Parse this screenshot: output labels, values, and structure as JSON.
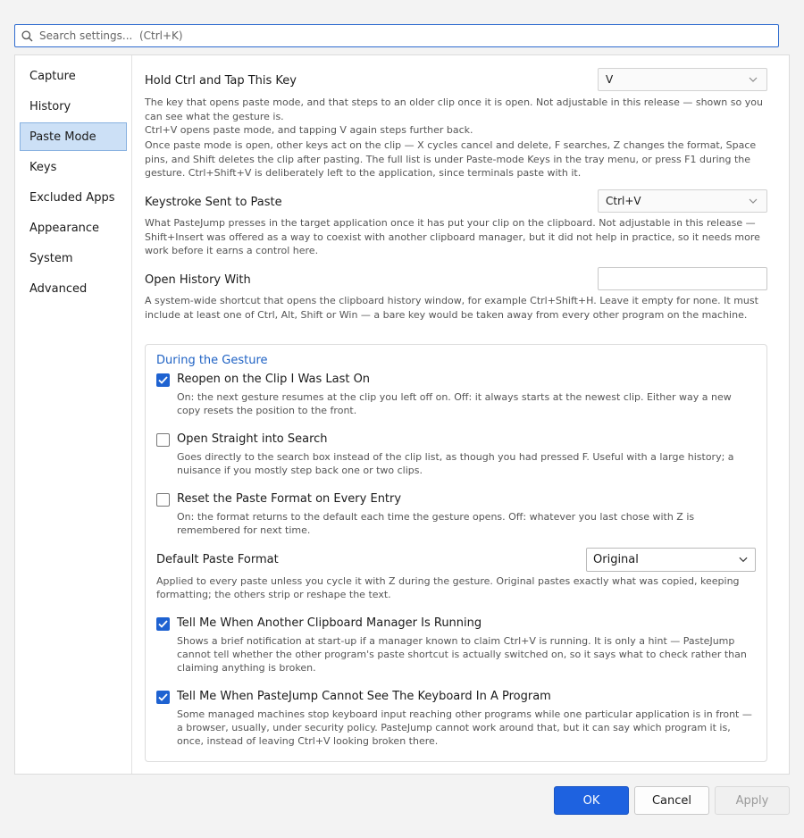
{
  "search": {
    "placeholder": "Search settings...  (Ctrl+K)",
    "value": ""
  },
  "sidebar": {
    "items": [
      {
        "label": "Capture"
      },
      {
        "label": "History"
      },
      {
        "label": "Paste Mode",
        "selected": true
      },
      {
        "label": "Keys"
      },
      {
        "label": "Excluded Apps"
      },
      {
        "label": "Appearance"
      },
      {
        "label": "System"
      },
      {
        "label": "Advanced"
      }
    ]
  },
  "settings": {
    "hold_key": {
      "title": "Hold Ctrl and Tap This Key",
      "value": "V",
      "desc1": "The key that opens paste mode, and that steps to an older clip once it is open. Not adjustable in this release — shown so you can see what the gesture is.",
      "desc2": "Ctrl+V opens paste mode, and tapping V again steps further back.",
      "desc3": "Once paste mode is open, other keys act on the clip — X cycles cancel and delete, F searches, Z changes the format, Space pins, and Shift deletes the clip after pasting. The full list is under Paste-mode Keys in the tray menu, or press F1 during the gesture. Ctrl+Shift+V is deliberately left to the application, since terminals paste with it."
    },
    "keystroke": {
      "title": "Keystroke Sent to Paste",
      "value": "Ctrl+V",
      "desc": "What PasteJump presses in the target application once it has put your clip on the clipboard. Not adjustable in this release — Shift+Insert was offered as a way to coexist with another clipboard manager, but it did not help in practice, so it needs more work before it earns a control here."
    },
    "open_history": {
      "title": "Open History With",
      "value": "",
      "desc": "A system-wide shortcut that opens the clipboard history window, for example Ctrl+Shift+H. Leave it empty for none. It must include at least one of Ctrl, Alt, Shift or Win — a bare key would be taken away from every other program on the machine."
    }
  },
  "gesture": {
    "title": "During the Gesture",
    "options": [
      {
        "label": "Reopen on the Clip I Was Last On",
        "checked": true,
        "desc": "On: the next gesture resumes at the clip you left off on. Off: it always starts at the newest clip. Either way a new copy resets the position to the front."
      },
      {
        "label": "Open Straight into Search",
        "checked": false,
        "desc": "Goes directly to the search box instead of the clip list, as though you had pressed F. Useful with a large history; a nuisance if you mostly step back one or two clips."
      },
      {
        "label": "Reset the Paste Format on Every Entry",
        "checked": false,
        "desc": "On: the format returns to the default each time the gesture opens. Off: whatever you last chose with Z is remembered for next time."
      }
    ],
    "default_format": {
      "label": "Default Paste Format",
      "value": "Original",
      "desc": "Applied to every paste unless you cycle it with Z during the gesture. Original pastes exactly what was copied, keeping formatting; the others strip or reshape the text."
    },
    "notices": [
      {
        "label": "Tell Me When Another Clipboard Manager Is Running",
        "checked": true,
        "desc": "Shows a brief notification at start-up if a manager known to claim Ctrl+V is running. It is only a hint — PasteJump cannot tell whether the other program's paste shortcut is actually switched on, so it says what to check rather than claiming anything is broken."
      },
      {
        "label": "Tell Me When PasteJump Cannot See The Keyboard In A Program",
        "checked": true,
        "desc": "Some managed machines stop keyboard input reaching other programs while one particular application is in front — a browser, usually, under security policy. PasteJump cannot work around that, but it can say which program it is, once, instead of leaving Ctrl+V looking broken there."
      }
    ]
  },
  "buttons": {
    "ok": "OK",
    "cancel": "Cancel",
    "apply": "Apply"
  },
  "colors": {
    "accent": "#1e62e0",
    "selected_nav_bg": "#cce0f6",
    "group_title": "#1f62c4"
  }
}
